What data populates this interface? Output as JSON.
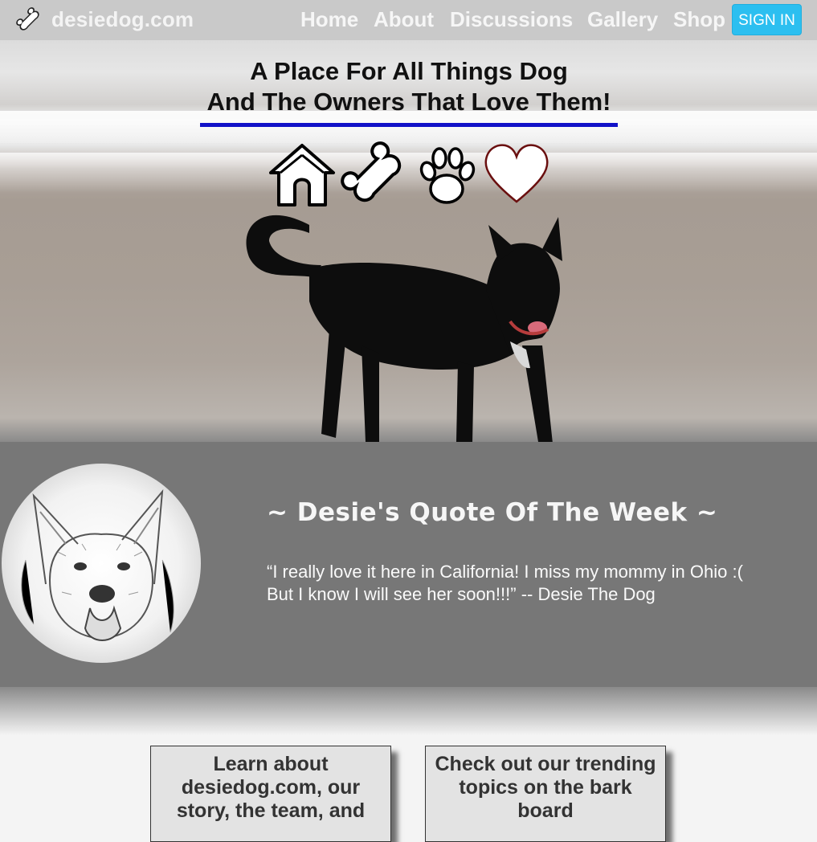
{
  "nav": {
    "brand": "desiedog.com",
    "links": [
      {
        "label": "Home"
      },
      {
        "label": "About"
      },
      {
        "label": "Discussions"
      },
      {
        "label": "Gallery"
      },
      {
        "label": "Shop"
      }
    ],
    "signin_label": "SIGN IN",
    "signin_color": "#2cbff0"
  },
  "hero": {
    "tagline_line1": "A Place For All Things Dog",
    "tagline_line2": "And The Owners That Love Them!",
    "underline_color": "#1212c8",
    "icons": [
      "house-icon",
      "bone-icon",
      "paw-icon",
      "heart-icon"
    ]
  },
  "quote": {
    "title": "~ Desie's Quote Of The Week ~",
    "text": "“I really love it here in California! I miss my mommy in Ohio :( But I know I will see her soon!!!” -- Desie The Dog"
  },
  "cards": [
    {
      "text": "Learn about desiedog.com, our story, the team, and"
    },
    {
      "text": "Check out our trending topics on the bark board"
    }
  ]
}
